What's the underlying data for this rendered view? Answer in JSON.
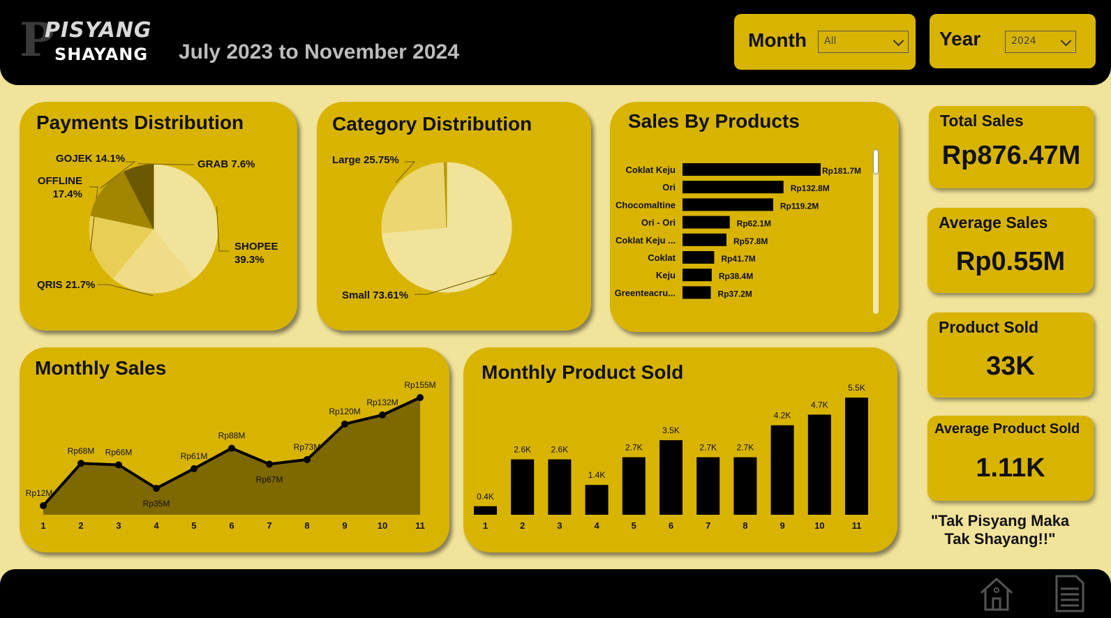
{
  "header": {
    "brand_line1": "PISYANG",
    "brand_line2": "SHAYANG",
    "subtitle": "July 2023 to November 2024"
  },
  "slicers": {
    "month": {
      "label": "Month",
      "value": "All"
    },
    "year": {
      "label": "Year",
      "value": "2024"
    }
  },
  "cards": {
    "payments_title": "Payments Distribution",
    "category_title": "Category Distribution",
    "products_title": "Sales By Products",
    "monthly_sales_title": "Monthly Sales",
    "monthly_sold_title": "Monthly Product Sold"
  },
  "kpis": [
    {
      "title": "Total Sales",
      "value": "Rp876.47M"
    },
    {
      "title": "Average Sales",
      "value": "Rp0.55M"
    },
    {
      "title": "Product Sold",
      "value": "33K"
    },
    {
      "title": "Average Product Sold",
      "value": "1.11K"
    }
  ],
  "quote": "\"Tak Pisyang Maka Tak Shayang!!\"",
  "colors": {
    "accent": "#d8b400",
    "background": "#f1e39a",
    "bar": "#000000",
    "header": "#000000"
  },
  "icons": [
    "home-icon",
    "report-icon"
  ],
  "chart_data": [
    {
      "id": "payments",
      "type": "pie",
      "title": "Payments Distribution",
      "slices": [
        {
          "label": "SHOPEE",
          "pct_label": "39.3%",
          "value": 39.3,
          "color": "#f1e39a"
        },
        {
          "label": "QRIS",
          "pct_label": "21.7%",
          "value": 21.7,
          "color": "#f0dc86"
        },
        {
          "label": "OFFLINE",
          "pct_label": "17.4%",
          "value": 17.4,
          "color": "#e8ce55"
        },
        {
          "label": "GOJEK",
          "pct_label": "14.1%",
          "value": 14.1,
          "color": "#a38600"
        },
        {
          "label": "GRAB",
          "pct_label": "7.6%",
          "value": 7.6,
          "color": "#6b5800"
        }
      ]
    },
    {
      "id": "category",
      "type": "pie",
      "title": "Category Distribution",
      "slices": [
        {
          "label": "Small",
          "pct_label": "73.61%",
          "value": 73.61,
          "color": "#f1e39a"
        },
        {
          "label": "Large",
          "pct_label": "25.75%",
          "value": 25.75,
          "color": "#ecd671"
        },
        {
          "label": "",
          "pct_label": "",
          "value": 0.64,
          "color": "#b89a00"
        }
      ]
    },
    {
      "id": "products",
      "type": "bar",
      "orientation": "horizontal",
      "title": "Sales By Products",
      "categories": [
        "Coklat Keju",
        "Ori",
        "Chocomaltine",
        "Ori - Ori",
        "Coklat Keju ...",
        "Coklat",
        "Keju",
        "Greenteacru..."
      ],
      "values": [
        181.7,
        132.8,
        119.2,
        62.1,
        57.8,
        41.7,
        38.4,
        37.2
      ],
      "labels": [
        "Rp181.7M",
        "Rp132.8M",
        "Rp119.2M",
        "Rp62.1M",
        "Rp57.8M",
        "Rp41.7M",
        "Rp38.4M",
        "Rp37.2M"
      ]
    },
    {
      "id": "monthly_sales",
      "type": "area",
      "title": "Monthly Sales",
      "x": [
        "1",
        "2",
        "3",
        "4",
        "5",
        "6",
        "7",
        "8",
        "9",
        "10",
        "11"
      ],
      "values": [
        12,
        68,
        66,
        35,
        61,
        88,
        67,
        73,
        120,
        132,
        155
      ],
      "labels": [
        "Rp12M",
        "Rp68M",
        "Rp66M",
        "Rp35M",
        "Rp61M",
        "Rp88M",
        "Rp67M",
        "Rp73M",
        "Rp120M",
        "Rp132M",
        "Rp155M"
      ],
      "ylim": [
        0,
        155
      ]
    },
    {
      "id": "monthly_sold",
      "type": "bar",
      "title": "Monthly Product Sold",
      "categories": [
        "1",
        "2",
        "3",
        "4",
        "5",
        "6",
        "7",
        "8",
        "9",
        "10",
        "11"
      ],
      "values": [
        0.4,
        2.6,
        2.6,
        1.4,
        2.7,
        3.5,
        2.7,
        2.7,
        4.2,
        4.7,
        5.5
      ],
      "labels": [
        "0.4K",
        "2.6K",
        "2.6K",
        "1.4K",
        "2.7K",
        "3.5K",
        "2.7K",
        "2.7K",
        "4.2K",
        "4.7K",
        "5.5K"
      ],
      "ylim": [
        0,
        5.5
      ]
    }
  ]
}
